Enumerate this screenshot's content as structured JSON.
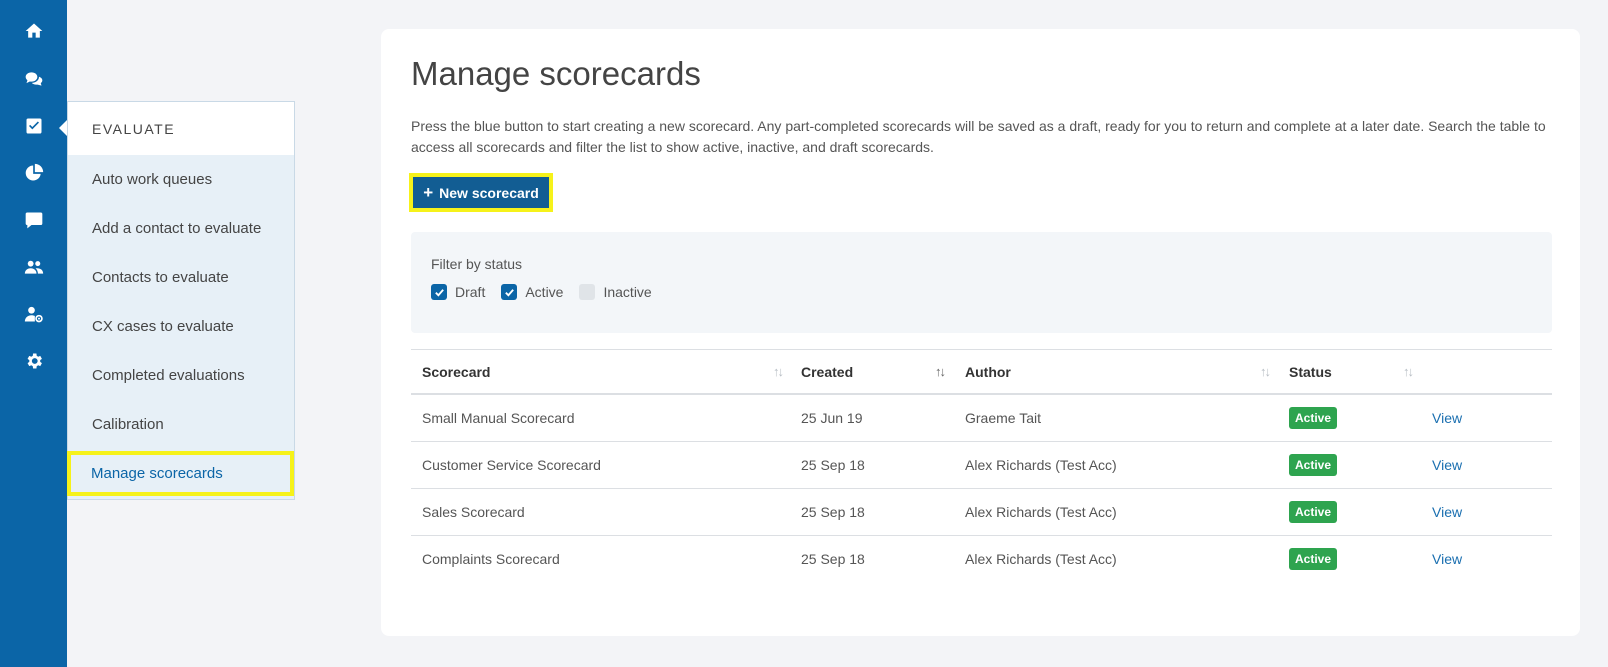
{
  "rail": {
    "items": [
      {
        "icon": "home-icon"
      },
      {
        "icon": "chat-bubbles-icon"
      },
      {
        "icon": "checkbox-icon"
      },
      {
        "icon": "pie-chart-icon"
      },
      {
        "icon": "comment-icon"
      },
      {
        "icon": "users-icon"
      },
      {
        "icon": "user-settings-icon"
      },
      {
        "icon": "gear-icon"
      }
    ],
    "color": "#0b65a7"
  },
  "submenu": {
    "header": "EVALUATE",
    "items": [
      {
        "label": "Auto work queues"
      },
      {
        "label": "Add a contact to evaluate"
      },
      {
        "label": "Contacts to evaluate"
      },
      {
        "label": "CX cases to evaluate"
      },
      {
        "label": "Completed evaluations"
      },
      {
        "label": "Calibration"
      },
      {
        "label": "Manage scorecards"
      }
    ],
    "selected": "Manage scorecards"
  },
  "main": {
    "title": "Manage scorecards",
    "intro": "Press the blue button to start creating a new scorecard. Any part-completed scorecards will be saved as a draft, ready for you to return and complete at a later date. Search the table to access all scorecards and filter the list to show active, inactive, and draft scorecards.",
    "new_button": "New scorecard",
    "filter": {
      "label": "Filter by status",
      "options": [
        {
          "label": "Draft",
          "checked": true
        },
        {
          "label": "Active",
          "checked": true
        },
        {
          "label": "Inactive",
          "checked": false
        }
      ]
    },
    "table": {
      "columns": [
        "Scorecard",
        "Created",
        "Author",
        "Status"
      ],
      "rows": [
        {
          "scorecard": "Small Manual Scorecard",
          "created": "25 Jun 19",
          "author": "Graeme Tait",
          "status": "Active",
          "action": "View"
        },
        {
          "scorecard": "Customer Service Scorecard",
          "created": "25 Sep 18",
          "author": "Alex Richards (Test Acc)",
          "status": "Active",
          "action": "View"
        },
        {
          "scorecard": "Sales Scorecard",
          "created": "25 Sep 18",
          "author": "Alex Richards (Test Acc)",
          "status": "Active",
          "action": "View"
        },
        {
          "scorecard": "Complaints Scorecard",
          "created": "25 Sep 18",
          "author": "Alex Richards (Test Acc)",
          "status": "Active",
          "action": "View"
        }
      ]
    }
  },
  "colors": {
    "primary": "#0b65a7",
    "highlight": "#f6f21a",
    "active_badge": "#2ea44f"
  }
}
